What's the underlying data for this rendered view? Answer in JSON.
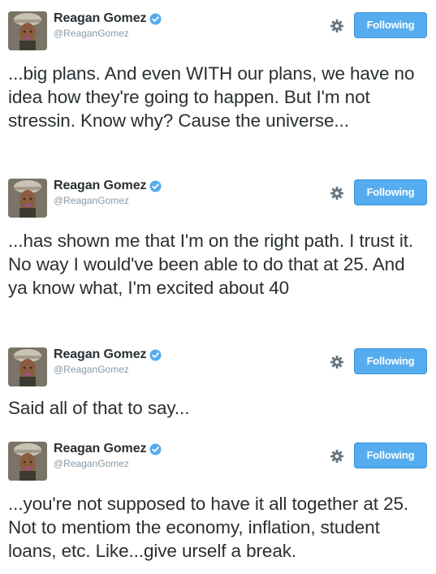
{
  "account": {
    "name": "Reagan Gomez",
    "handle": "@ReaganGomez",
    "verified": true
  },
  "follow_button_label": "Following",
  "colors": {
    "follow_button": "#55acee",
    "verified_badge": "#55acee",
    "handle_text": "#8899a6",
    "tweet_text": "#292f33"
  },
  "icons": {
    "settings": "gear-icon",
    "verified": "verified-badge-icon"
  },
  "tweets": [
    {
      "name": "Reagan Gomez",
      "handle": "@ReaganGomez",
      "button": "Following",
      "text": "...big plans. And even WITH our plans, we have no idea how they're going to happen. But I'm not stressin. Know why? Cause the universe..."
    },
    {
      "name": "Reagan Gomez",
      "handle": "@ReaganGomez",
      "button": "Following",
      "text": "...has shown me that I'm on the right path. I trust it. No way I would've been able to do that at 25. And ya know what, I'm excited about 40"
    },
    {
      "name": "Reagan Gomez",
      "handle": "@ReaganGomez",
      "button": "Following",
      "text": "Said all of that to say..."
    },
    {
      "name": "Reagan Gomez",
      "handle": "@ReaganGomez",
      "button": "Following",
      "text": "...you're not supposed to have it all together at 25. Not to mentiom the economy, inflation, student loans, etc. Like...give urself a break."
    }
  ]
}
